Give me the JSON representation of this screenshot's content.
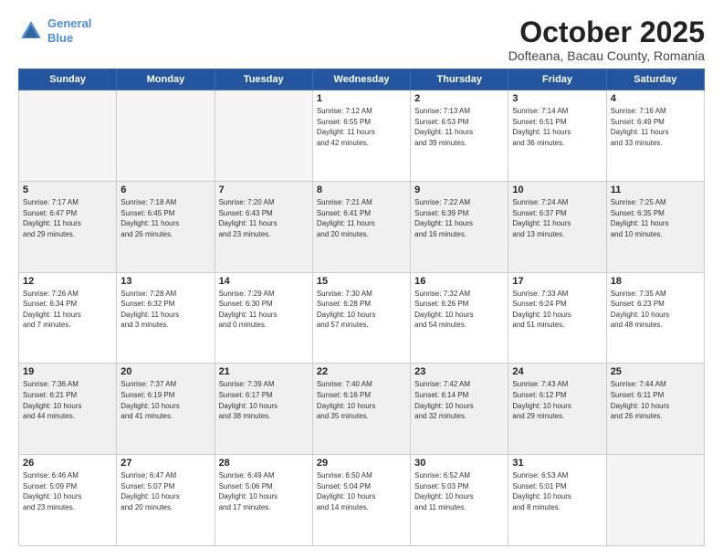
{
  "header": {
    "logo_line1": "General",
    "logo_line2": "Blue",
    "month": "October 2025",
    "location": "Dofteana, Bacau County, Romania"
  },
  "weekdays": [
    "Sunday",
    "Monday",
    "Tuesday",
    "Wednesday",
    "Thursday",
    "Friday",
    "Saturday"
  ],
  "weeks": [
    [
      {
        "day": "",
        "content": ""
      },
      {
        "day": "",
        "content": ""
      },
      {
        "day": "",
        "content": ""
      },
      {
        "day": "1",
        "content": "Sunrise: 7:12 AM\nSunset: 6:55 PM\nDaylight: 11 hours\nand 42 minutes."
      },
      {
        "day": "2",
        "content": "Sunrise: 7:13 AM\nSunset: 6:53 PM\nDaylight: 11 hours\nand 39 minutes."
      },
      {
        "day": "3",
        "content": "Sunrise: 7:14 AM\nSunset: 6:51 PM\nDaylight: 11 hours\nand 36 minutes."
      },
      {
        "day": "4",
        "content": "Sunrise: 7:16 AM\nSunset: 6:49 PM\nDaylight: 11 hours\nand 33 minutes."
      }
    ],
    [
      {
        "day": "5",
        "content": "Sunrise: 7:17 AM\nSunset: 6:47 PM\nDaylight: 11 hours\nand 29 minutes."
      },
      {
        "day": "6",
        "content": "Sunrise: 7:18 AM\nSunset: 6:45 PM\nDaylight: 11 hours\nand 26 minutes."
      },
      {
        "day": "7",
        "content": "Sunrise: 7:20 AM\nSunset: 6:43 PM\nDaylight: 11 hours\nand 23 minutes."
      },
      {
        "day": "8",
        "content": "Sunrise: 7:21 AM\nSunset: 6:41 PM\nDaylight: 11 hours\nand 20 minutes."
      },
      {
        "day": "9",
        "content": "Sunrise: 7:22 AM\nSunset: 6:39 PM\nDaylight: 11 hours\nand 16 minutes."
      },
      {
        "day": "10",
        "content": "Sunrise: 7:24 AM\nSunset: 6:37 PM\nDaylight: 11 hours\nand 13 minutes."
      },
      {
        "day": "11",
        "content": "Sunrise: 7:25 AM\nSunset: 6:35 PM\nDaylight: 11 hours\nand 10 minutes."
      }
    ],
    [
      {
        "day": "12",
        "content": "Sunrise: 7:26 AM\nSunset: 6:34 PM\nDaylight: 11 hours\nand 7 minutes."
      },
      {
        "day": "13",
        "content": "Sunrise: 7:28 AM\nSunset: 6:32 PM\nDaylight: 11 hours\nand 3 minutes."
      },
      {
        "day": "14",
        "content": "Sunrise: 7:29 AM\nSunset: 6:30 PM\nDaylight: 11 hours\nand 0 minutes."
      },
      {
        "day": "15",
        "content": "Sunrise: 7:30 AM\nSunset: 6:28 PM\nDaylight: 10 hours\nand 57 minutes."
      },
      {
        "day": "16",
        "content": "Sunrise: 7:32 AM\nSunset: 6:26 PM\nDaylight: 10 hours\nand 54 minutes."
      },
      {
        "day": "17",
        "content": "Sunrise: 7:33 AM\nSunset: 6:24 PM\nDaylight: 10 hours\nand 51 minutes."
      },
      {
        "day": "18",
        "content": "Sunrise: 7:35 AM\nSunset: 6:23 PM\nDaylight: 10 hours\nand 48 minutes."
      }
    ],
    [
      {
        "day": "19",
        "content": "Sunrise: 7:36 AM\nSunset: 6:21 PM\nDaylight: 10 hours\nand 44 minutes."
      },
      {
        "day": "20",
        "content": "Sunrise: 7:37 AM\nSunset: 6:19 PM\nDaylight: 10 hours\nand 41 minutes."
      },
      {
        "day": "21",
        "content": "Sunrise: 7:39 AM\nSunset: 6:17 PM\nDaylight: 10 hours\nand 38 minutes."
      },
      {
        "day": "22",
        "content": "Sunrise: 7:40 AM\nSunset: 6:16 PM\nDaylight: 10 hours\nand 35 minutes."
      },
      {
        "day": "23",
        "content": "Sunrise: 7:42 AM\nSunset: 6:14 PM\nDaylight: 10 hours\nand 32 minutes."
      },
      {
        "day": "24",
        "content": "Sunrise: 7:43 AM\nSunset: 6:12 PM\nDaylight: 10 hours\nand 29 minutes."
      },
      {
        "day": "25",
        "content": "Sunrise: 7:44 AM\nSunset: 6:11 PM\nDaylight: 10 hours\nand 26 minutes."
      }
    ],
    [
      {
        "day": "26",
        "content": "Sunrise: 6:46 AM\nSunset: 5:09 PM\nDaylight: 10 hours\nand 23 minutes."
      },
      {
        "day": "27",
        "content": "Sunrise: 6:47 AM\nSunset: 5:07 PM\nDaylight: 10 hours\nand 20 minutes."
      },
      {
        "day": "28",
        "content": "Sunrise: 6:49 AM\nSunset: 5:06 PM\nDaylight: 10 hours\nand 17 minutes."
      },
      {
        "day": "29",
        "content": "Sunrise: 6:50 AM\nSunset: 5:04 PM\nDaylight: 10 hours\nand 14 minutes."
      },
      {
        "day": "30",
        "content": "Sunrise: 6:52 AM\nSunset: 5:03 PM\nDaylight: 10 hours\nand 11 minutes."
      },
      {
        "day": "31",
        "content": "Sunrise: 6:53 AM\nSunset: 5:01 PM\nDaylight: 10 hours\nand 8 minutes."
      },
      {
        "day": "",
        "content": ""
      }
    ]
  ]
}
